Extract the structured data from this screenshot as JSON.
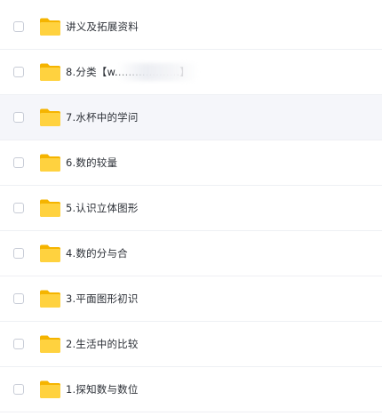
{
  "items": [
    {
      "name": "讲义及拓展资料",
      "icon": "folder-icon",
      "highlighted": false
    },
    {
      "name": "8.分类【w...................】",
      "icon": "folder-icon",
      "highlighted": false
    },
    {
      "name": "7.水杯中的学问",
      "icon": "folder-icon",
      "highlighted": true
    },
    {
      "name": "6.数的较量",
      "icon": "folder-icon",
      "highlighted": false
    },
    {
      "name": "5.认识立体图形",
      "icon": "folder-icon",
      "highlighted": false
    },
    {
      "name": "4.数的分与合",
      "icon": "folder-icon",
      "highlighted": false
    },
    {
      "name": "3.平面图形初识",
      "icon": "folder-icon",
      "highlighted": false
    },
    {
      "name": "2.生活中的比较",
      "icon": "folder-icon",
      "highlighted": false
    },
    {
      "name": "1.探知数与数位",
      "icon": "folder-icon",
      "highlighted": false
    }
  ],
  "colors": {
    "folder_back": "#f5b400",
    "folder_front": "#ffd23f",
    "highlight_row": "#f5f6fa",
    "text": "#2b2f36"
  }
}
